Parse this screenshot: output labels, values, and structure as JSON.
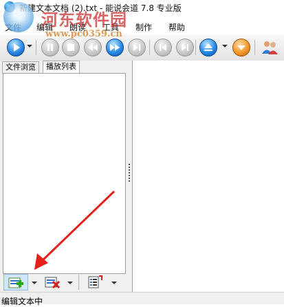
{
  "window": {
    "title": "新建文本文档 (2).txt - 能说会道 7.8 专业版"
  },
  "menu": {
    "items": [
      {
        "label": "文件"
      },
      {
        "label": "编辑"
      },
      {
        "label": "朗读"
      },
      {
        "label": "工具"
      },
      {
        "label": "制作"
      },
      {
        "label": "帮助"
      }
    ]
  },
  "watermark": {
    "title": "河东软件园",
    "url": "www.pc0359.cn"
  },
  "tabs": [
    {
      "label": "文件浏览"
    },
    {
      "label": "播放列表"
    }
  ],
  "active_tab": "播放列表",
  "status": {
    "text": "编辑文本中"
  },
  "colors": {
    "arrow": "#e5201b",
    "toolbar_active": "#2b8be6",
    "toolbar_orange": "#f29a2a"
  },
  "toolbar": {
    "buttons": [
      {
        "icon": "play-icon",
        "state": "active",
        "has_dropdown": true
      },
      {
        "icon": "pause-icon",
        "state": "disabled"
      },
      {
        "icon": "stop-icon",
        "state": "disabled"
      },
      {
        "icon": "rewind-icon",
        "state": "disabled"
      },
      {
        "icon": "fast-forward-icon",
        "state": "active"
      },
      {
        "icon": "skip-end-icon",
        "state": "disabled"
      },
      {
        "icon": "previous-icon",
        "state": "disabled"
      },
      {
        "icon": "next-icon",
        "state": "disabled"
      },
      {
        "icon": "eject-icon",
        "state": "active",
        "has_dropdown": true
      },
      {
        "icon": "download-icon",
        "state": "active"
      },
      {
        "icon": "users-icon",
        "state": "active"
      }
    ]
  },
  "playlist_toolbar": {
    "buttons": [
      {
        "icon": "add-to-list-icon",
        "has_dropdown": true
      },
      {
        "icon": "remove-from-list-icon",
        "has_dropdown": true
      },
      {
        "icon": "playlist-options-icon",
        "has_dropdown": true
      }
    ]
  }
}
